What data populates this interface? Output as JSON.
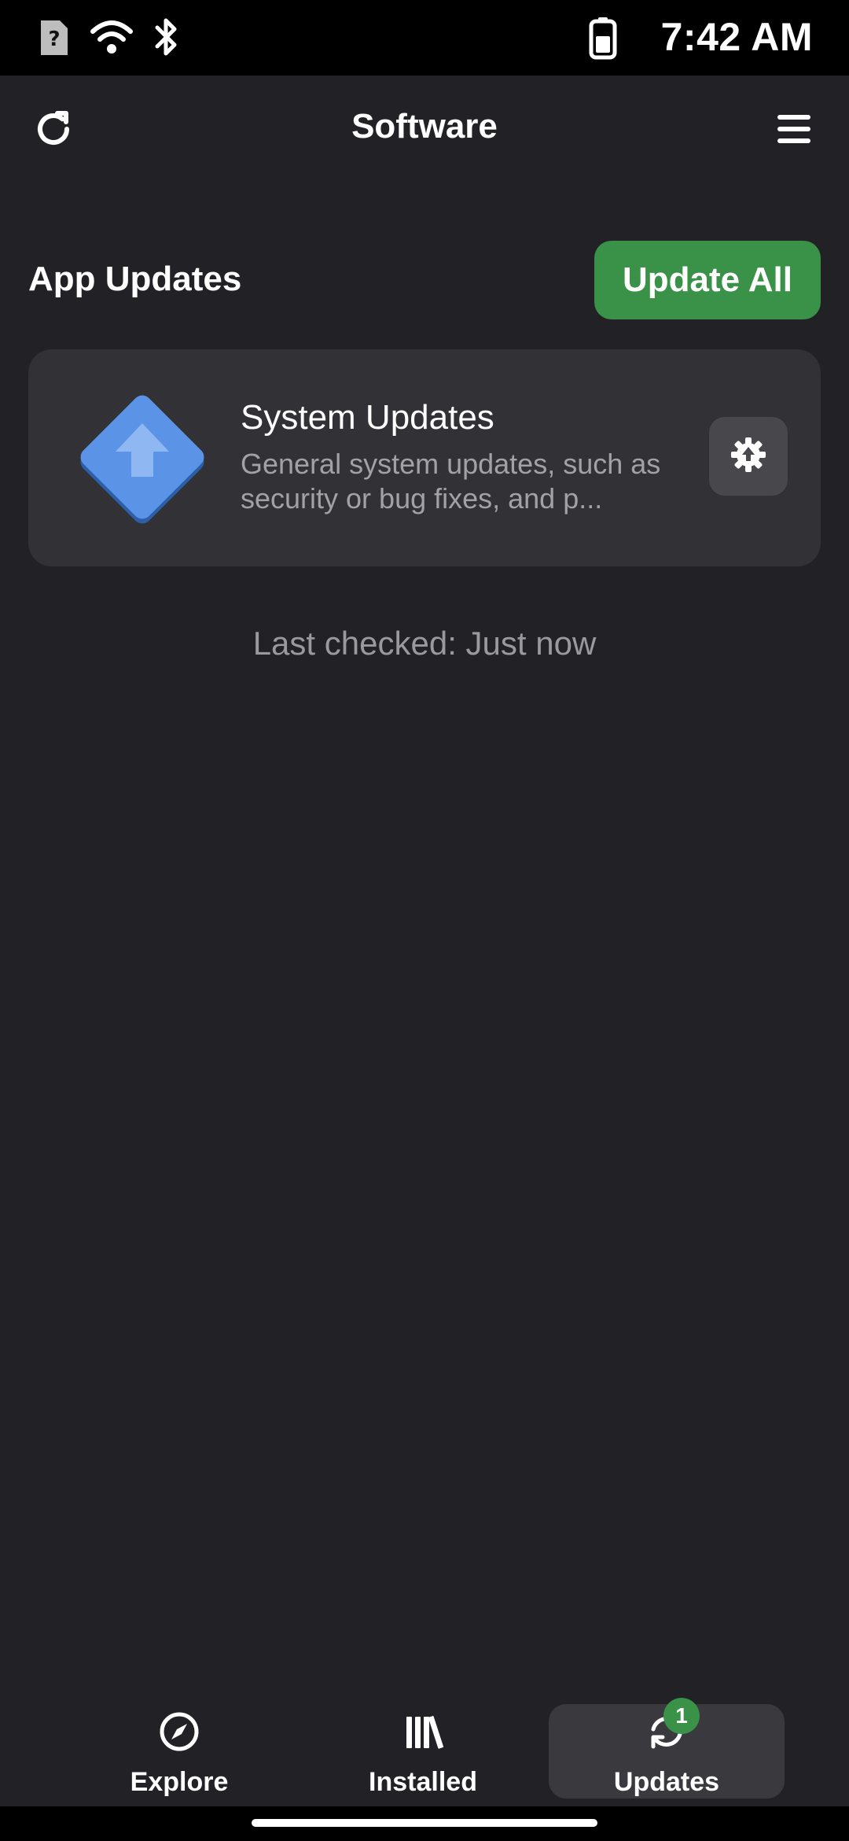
{
  "status_bar": {
    "time": "7:42 AM",
    "icons": [
      "sim-unknown-icon",
      "wifi-icon",
      "bluetooth-icon",
      "battery-icon"
    ]
  },
  "header": {
    "title": "Software",
    "left_icon": "refresh-icon",
    "right_icon": "menu-icon"
  },
  "updates": {
    "section_title": "App Updates",
    "update_all_label": "Update All",
    "items": [
      {
        "title": "System Updates",
        "description": "General system updates, such as security or bug fixes, and p...",
        "icon": "system-update-icon",
        "action_icon": "upload-gear-icon"
      }
    ],
    "last_checked": "Last checked: Just now"
  },
  "bottom_nav": {
    "items": [
      {
        "label": "Explore",
        "icon": "compass-icon",
        "active": false
      },
      {
        "label": "Installed",
        "icon": "library-icon",
        "active": false
      },
      {
        "label": "Updates",
        "icon": "sync-icon",
        "active": true,
        "badge": "1"
      }
    ]
  },
  "colors": {
    "background": "#222226",
    "card": "#323236",
    "accent_green": "#3a9148",
    "secondary_text": "#a2a2a6"
  }
}
